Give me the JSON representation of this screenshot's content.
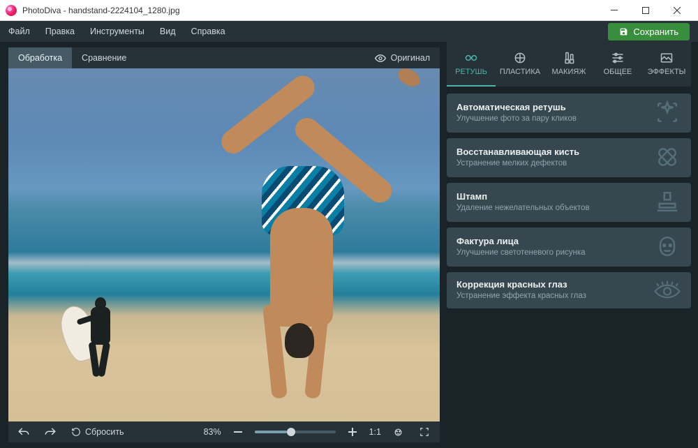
{
  "titlebar": {
    "app_title": "PhotoDiva - handstand-2224104_1280.jpg"
  },
  "menubar": {
    "items": [
      "Файл",
      "Правка",
      "Инструменты",
      "Вид",
      "Справка"
    ],
    "save_label": "Сохранить"
  },
  "left_tabs": {
    "processing": "Обработка",
    "compare": "Сравнение",
    "original": "Оригинал"
  },
  "bottombar": {
    "reset": "Сбросить",
    "zoom_value": "83%",
    "one_to_one": "1:1"
  },
  "mode_tabs": {
    "items": [
      {
        "label": "РЕТУШЬ",
        "name": "retouch",
        "active": true
      },
      {
        "label": "ПЛАСТИКА",
        "name": "liquify",
        "active": false
      },
      {
        "label": "МАКИЯЖ",
        "name": "makeup",
        "active": false
      },
      {
        "label": "ОБЩЕЕ",
        "name": "general",
        "active": false
      },
      {
        "label": "ЭФФЕКТЫ",
        "name": "effects",
        "active": false
      }
    ]
  },
  "tools": [
    {
      "title": "Автоматическая ретушь",
      "desc": "Улучшение фото за пару кликов",
      "icon": "sparkle"
    },
    {
      "title": "Восстанавливающая кисть",
      "desc": "Устранение мелких дефектов",
      "icon": "bandage"
    },
    {
      "title": "Штамп",
      "desc": "Удаление нежелательных объектов",
      "icon": "stamp"
    },
    {
      "title": "Фактура лица",
      "desc": "Улучшение светотеневого рисунка",
      "icon": "face"
    },
    {
      "title": "Коррекция красных глаз",
      "desc": "Устранение эффекта красных глаз",
      "icon": "eye"
    }
  ]
}
